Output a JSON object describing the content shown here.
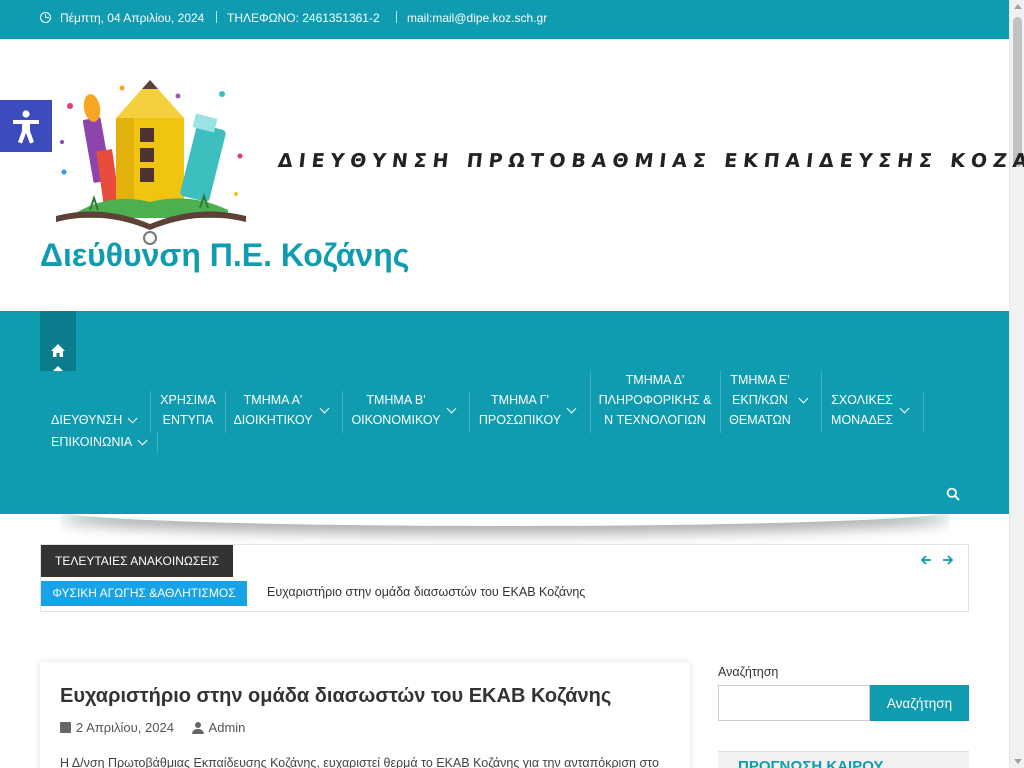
{
  "topbar": {
    "date": "Πέμπτη, 04 Απριλίου, 2024",
    "phone": "ΤΗΛΕΦΩΝΟ: 2461351361-2",
    "mail": "mail:mail@dipe.koz.sch.gr"
  },
  "header": {
    "banner_text": "ΔΙΕΥΘΥΝΣΗ ΠΡΩΤΟΒΑΘΜΙΑΣ ΕΚΠΑΙΔΕΥΣΗΣ ΚΟΖΑΝΗΣ",
    "site_title": "Διεύθυνση Π.Ε. Κοζάνης"
  },
  "nav": {
    "items": [
      {
        "label1": "ΔΙΕΥΘΥΝΣΗ",
        "label2": ""
      },
      {
        "label1": "ΧΡΗΣΙΜΑ",
        "label2": "ΕΝΤΥΠΑ"
      },
      {
        "label1": "ΤΜΗΜΑ Α'",
        "label2": "ΔΙΟΙΚΗΤΙΚΟΥ"
      },
      {
        "label1": "ΤΜΗΜΑ Β'",
        "label2": "ΟΙΚΟΝΟΜΙΚΟΥ"
      },
      {
        "label1": "ΤΜΗΜΑ Γ'",
        "label2": "ΠΡΟΣΩΠΙΚΟΥ"
      },
      {
        "label1": "ΤΜΗΜΑ Δ'",
        "label2": "ΠΛΗΡΟΦΟΡΙΚΗΣ &",
        "label3": "Ν ΤΕΧΝΟΛΟΓΙΩΝ"
      },
      {
        "label1": "ΤΜΗΜΑ Ε'",
        "label2": "ΕΚΠ/ΚΩΝ",
        "label3": "ΘΕΜΑΤΩΝ"
      },
      {
        "label1": "ΣΧΟΛΙΚΕΣ",
        "label2": "ΜΟΝΑΔΕΣ"
      },
      {
        "label1": "ΕΠΙΚΟΙΝΩΝΙΑ",
        "label2": ""
      }
    ]
  },
  "ticker": {
    "label": "ΤΕΛΕΥΤΑΙΕΣ ΑΝΑΚΟΙΝΩΣΕΙΣ",
    "category": "ΦΥΣΙΚΗ ΑΓΩΓΗΣ &ΑΘΛΗΤΙΣΜΟΣ",
    "headline": "Ευχαριστήριο στην ομάδα διασωστών του ΕΚΑΒ Κοζάνης"
  },
  "post": {
    "title": "Ευχαριστήριο στην ομάδα διασωστών του ΕΚΑΒ Κοζάνης",
    "date": "2 Απριλίου, 2024",
    "author": "Admin",
    "excerpt": "Η Δ/νση Πρωτοβάθμιας Εκπαίδευσης Κοζάνης, ευχαριστεί θερμά το ΕΚΑΒ Κοζάνης για την ανταπόκριση στο"
  },
  "sidebar": {
    "search_label": "Αναζήτηση",
    "search_placeholder": "",
    "search_button": "Αναζήτηση",
    "widget_title": "ΠΡΟΓΝΩΣΗ ΚΑΙΡΟΥ"
  },
  "colors": {
    "primary": "#0f9cb0",
    "dark": "#333333",
    "category": "#18a3e8",
    "accessibility": "#3c4cbc"
  }
}
